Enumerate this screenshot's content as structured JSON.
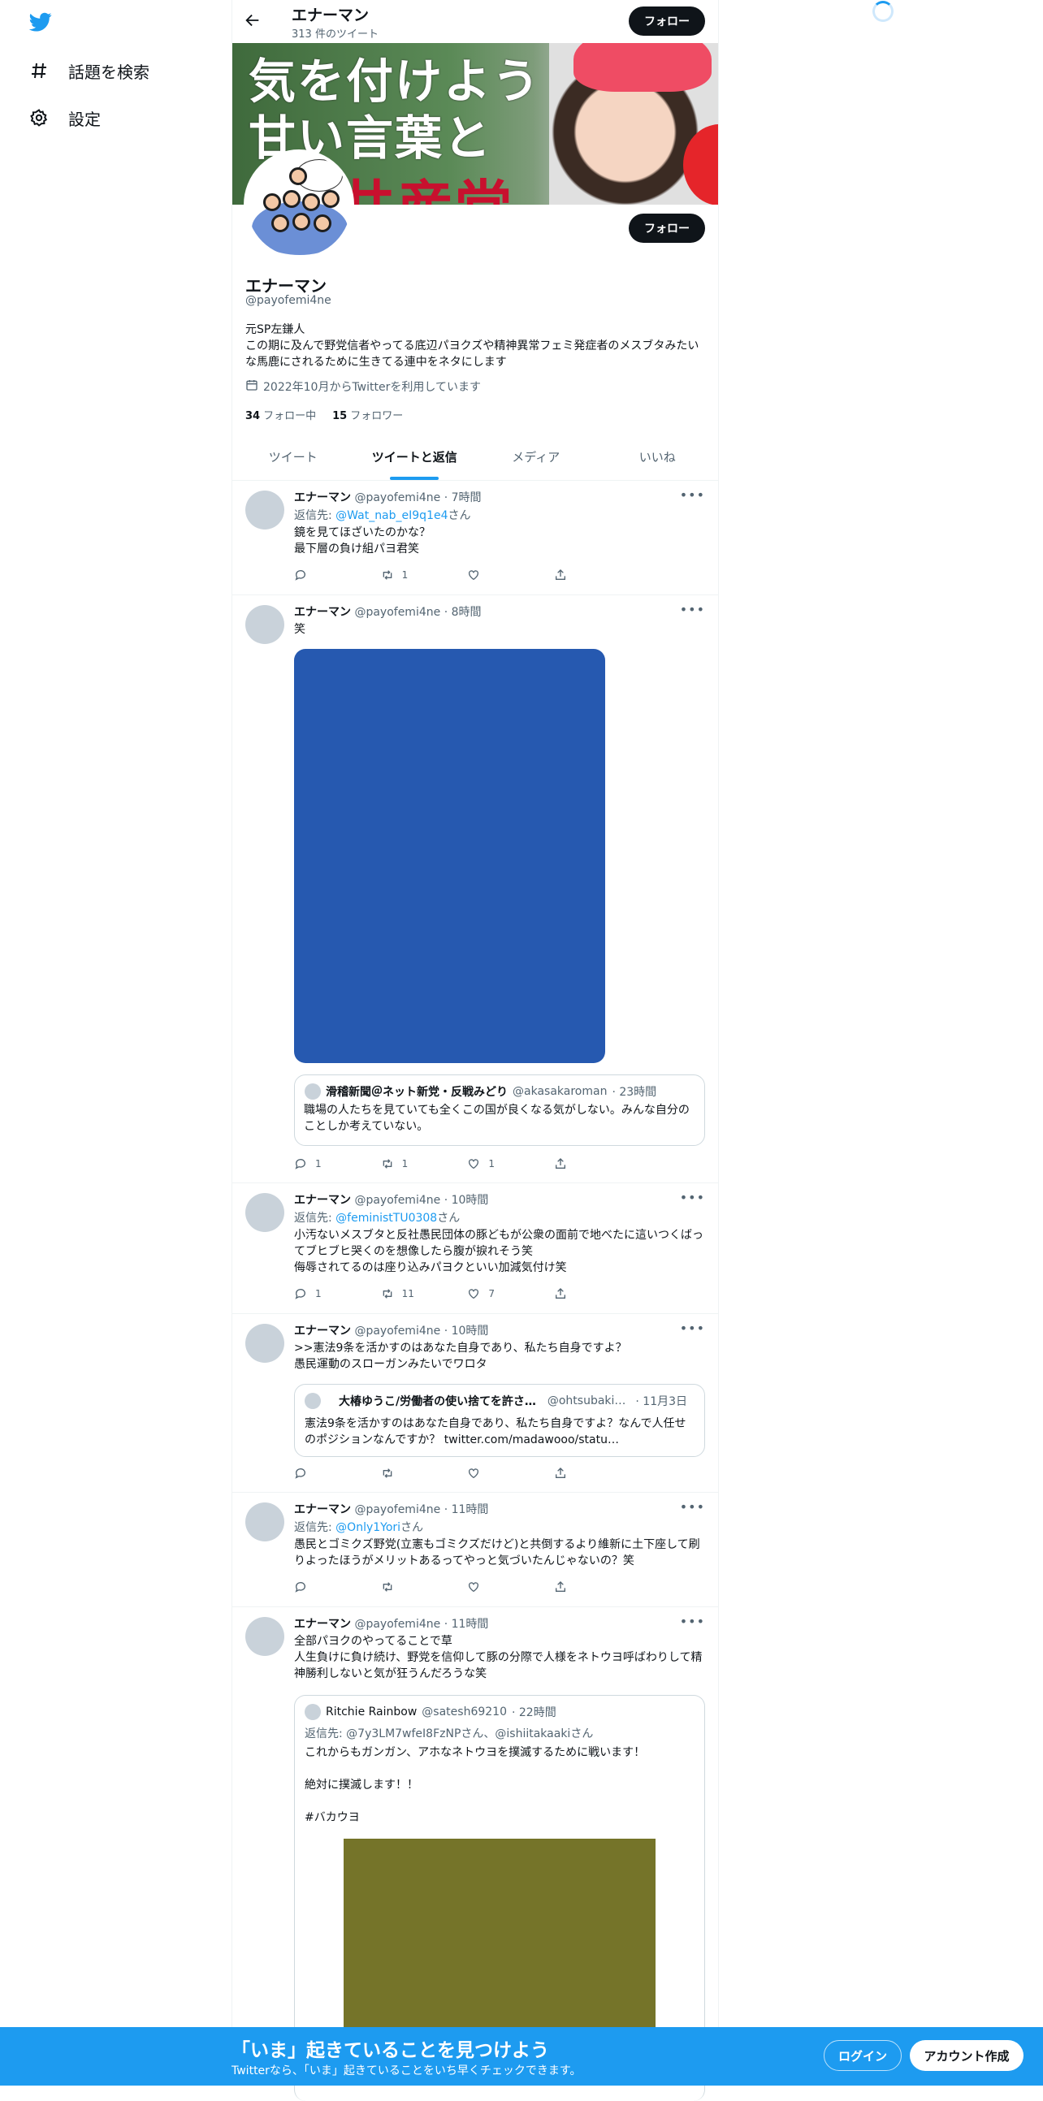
{
  "nav": {
    "explore_label": "話題を検索",
    "settings_label": "設定"
  },
  "header": {
    "name": "エナーマン",
    "tweet_count": "313 件のツイート",
    "follow_label": "フォロー"
  },
  "banner": {
    "line1": "気を付けよう",
    "line2": "甘い言葉と",
    "line3": "共産党"
  },
  "profile": {
    "name": "エナーマン",
    "handle": "@payofemi4ne",
    "bio": "元SP左鎌人\nこの期に及んで野党信者やってる底辺パヨクズや精神異常フェミ発症者のメスブタみたいな馬鹿にされるために生きてる連中をネタにします",
    "joined": "2022年10月からTwitterを利用しています",
    "following_count": "34",
    "following_label": "フォロー中",
    "followers_count": "15",
    "followers_label": "フォロワー",
    "follow_label": "フォロー"
  },
  "tabs": [
    "ツイート",
    "ツイートと返信",
    "メディア",
    "いいね"
  ],
  "tweets": [
    {
      "name": "エナーマン",
      "handle": "@payofemi4ne",
      "time": "· 7時間",
      "reply_prefix": "返信先: ",
      "reply_to": "@Wat_nab_eI9q1e4",
      "reply_suffix": "さん",
      "text": "鏡を見てほざいたのかな？\n最下層の負け組パヨ君笑",
      "replies": "",
      "retweets": "1",
      "likes": ""
    },
    {
      "name": "エナーマン",
      "handle": "@payofemi4ne",
      "time": "· 8時間",
      "text": "笑",
      "media_color": "#2659b0",
      "quote": {
        "name": "滑稽新聞＠ネット新党・反戦みどり",
        "handle": "@akasakaroman",
        "time": "· 23時間",
        "text": "職場の人たちを見ていても全くこの国が良くなる気がしない。みんな自分のことしか考えていない。"
      },
      "replies": "1",
      "retweets": "1",
      "likes": "1"
    },
    {
      "name": "エナーマン",
      "handle": "@payofemi4ne",
      "time": "· 10時間",
      "reply_prefix": "返信先: ",
      "reply_to": "@feministTU0308",
      "reply_suffix": "さん",
      "text": "小汚ないメスブタと反社愚民団体の豚どもが公衆の面前で地べたに這いつくばってブヒブヒ哭くのを想像したら腹が捩れそう笑\n侮辱されてるのは座り込みパヨクといい加減気付け笑",
      "replies": "1",
      "retweets": "11",
      "likes": "7"
    },
    {
      "name": "エナーマン",
      "handle": "@payofemi4ne",
      "time": "· 10時間",
      "text": ">>憲法9条を活かすのはあなた自身であり、私たち自身ですよ？\n愚民運動のスローガンみたいでワロタ",
      "quote": {
        "name": "大椿ゆうこ/労働者の使い捨てを許さ…",
        "handle": "@ohtsubaki…",
        "time": "· 11月3日",
        "text": "憲法9条を活かすのはあなた自身であり、私たち自身ですよ？なんで人任せのポジションなんですか？ twitter.com/madawooo/statu…"
      },
      "replies": "",
      "retweets": "",
      "likes": ""
    },
    {
      "name": "エナーマン",
      "handle": "@payofemi4ne",
      "time": "· 11時間",
      "reply_prefix": "返信先: ",
      "reply_to": "@Only1Yori",
      "reply_suffix": "さん",
      "text": "愚民とゴミクズ野党(立憲もゴミクズだけど)と共倒するより維新に土下座して刷りよったほうがメリットあるってやっと気づいたんじゃないの？笑",
      "replies": "",
      "retweets": "",
      "likes": ""
    },
    {
      "name": "エナーマン",
      "handle": "@payofemi4ne",
      "time": "· 11時間",
      "text": "全部パヨクのやってることで草\n人生負けに負け続け、野党を信仰して豚の分際で人様をネトウヨ呼ばわりして精神勝利しないと気が狂うんだろうな笑",
      "quote": {
        "name": "Ritchie Rainbow",
        "handle": "@satesh69210",
        "time": "· 22時間",
        "reply_prefix": "返信先: ",
        "reply_to": "@7y3LM7wfeI8FzNPさん、@ishiitakaakiさん",
        "text": "これからもガンガン、アホなネトウヨを撲滅するために戦います！\n\n絶対に撲滅します！！\n\n#バカウヨ",
        "media_color": "#757429"
      }
    }
  ],
  "bottom": {
    "title": "「いま」起きていることを見つけよう",
    "subtitle": "Twitterなら、「いま」起きていることをいち早くチェックできます。",
    "login_label": "ログイン",
    "signup_label": "アカウント作成"
  },
  "colors": {
    "accent": "#1d9bf0",
    "bottom_bar": "#1d9bf0"
  }
}
